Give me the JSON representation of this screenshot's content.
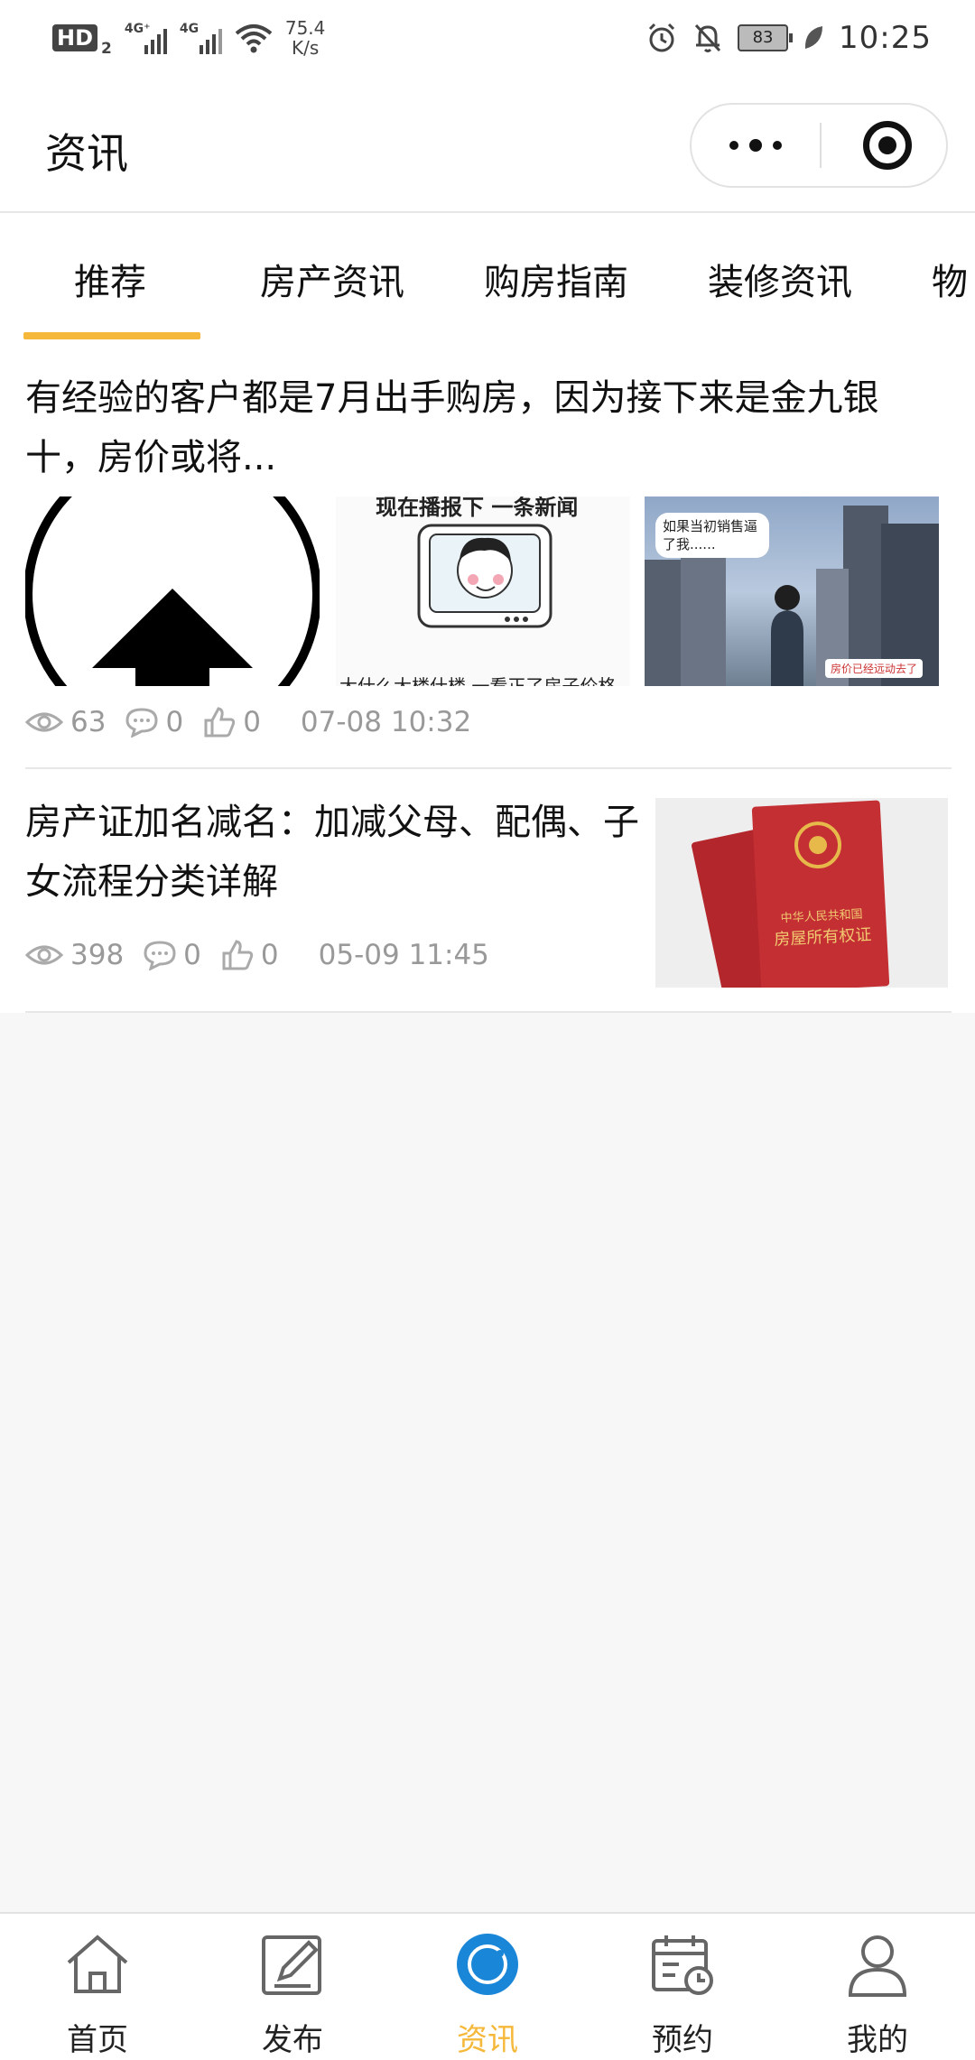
{
  "status_bar": {
    "hd_label": "HD",
    "hd_sub": "2",
    "sim1_type": "4G⁺",
    "sim2_type": "4G",
    "speed_value": "75.4",
    "speed_unit": "K/s",
    "battery": "83",
    "time": "10:25",
    "icons": [
      "alarm-icon",
      "bell-off-icon",
      "leaf-icon"
    ]
  },
  "title_bar": {
    "title": "资讯"
  },
  "tabs": {
    "active_color": "#f5b83a",
    "items": [
      {
        "label": "推荐"
      },
      {
        "label": "房产资讯"
      },
      {
        "label": "购房指南"
      },
      {
        "label": "装修资讯"
      },
      {
        "label": "物"
      }
    ]
  },
  "articles": [
    {
      "title": "有经验的客户都是7月出手购房，因为接下来是金九银十，房价或将...",
      "image_caption_tv": "现在播报下 一条新闻",
      "image_caption_tv_bottom": "大什么大楼什楼  一看正了房子价格",
      "image_bubble": "如果当初销售逼了我......",
      "image_note": "房价已经远动去了",
      "views": "63",
      "comments": "0",
      "likes": "0",
      "date": "07-08 10:32"
    },
    {
      "title": "房产证加名减名：加减父母、配偶、子女流程分类详解",
      "cert_line1": "中华人民共和国",
      "cert_line2": "房屋所有权证",
      "views": "398",
      "comments": "0",
      "likes": "0",
      "date": "05-09 11:45"
    }
  ],
  "tab_bar": {
    "active_color": "#f5b83a",
    "items": [
      {
        "label": "首页",
        "icon": "home-icon"
      },
      {
        "label": "发布",
        "icon": "edit-icon"
      },
      {
        "label": "资讯",
        "icon": "news-circle-icon"
      },
      {
        "label": "预约",
        "icon": "calendar-clock-icon"
      },
      {
        "label": "我的",
        "icon": "user-icon"
      }
    ]
  }
}
